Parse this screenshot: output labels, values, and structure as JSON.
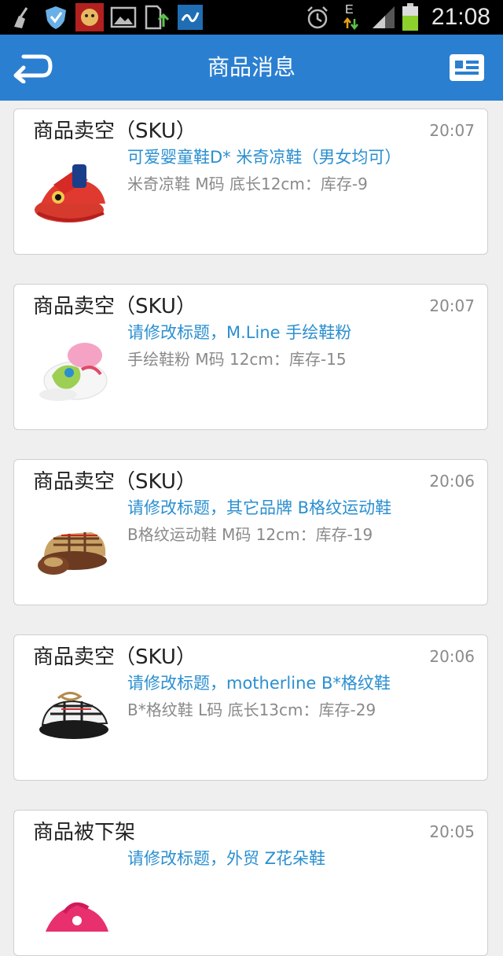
{
  "status_bar": {
    "time": "21:08",
    "network_label": "E"
  },
  "header": {
    "title": "商品消息"
  },
  "messages": [
    {
      "title": "商品卖空（SKU）",
      "time": "20:07",
      "product": "可爱婴童鞋D* 米奇凉鞋（男女均可）",
      "detail": "米奇凉鞋 M码 底长12cm：库存-9"
    },
    {
      "title": "商品卖空（SKU）",
      "time": "20:07",
      "product": "请修改标题，M.Line 手绘鞋粉",
      "detail": "手绘鞋粉 M码 12cm：库存-15"
    },
    {
      "title": "商品卖空（SKU）",
      "time": "20:06",
      "product": "请修改标题，其它品牌 B格纹运动鞋",
      "detail": "B格纹运动鞋 M码 12cm：库存-19"
    },
    {
      "title": "商品卖空（SKU）",
      "time": "20:06",
      "product": "请修改标题，motherline B*格纹鞋",
      "detail": "B*格纹鞋 L码 底长13cm：库存-29"
    },
    {
      "title": "商品被下架",
      "time": "20:05",
      "product": "请修改标题，外贸 Z花朵鞋",
      "detail": ""
    }
  ],
  "colors": {
    "app_bar": "#2a7fd1",
    "product_link": "#2a8fd0",
    "background": "#efefef"
  }
}
